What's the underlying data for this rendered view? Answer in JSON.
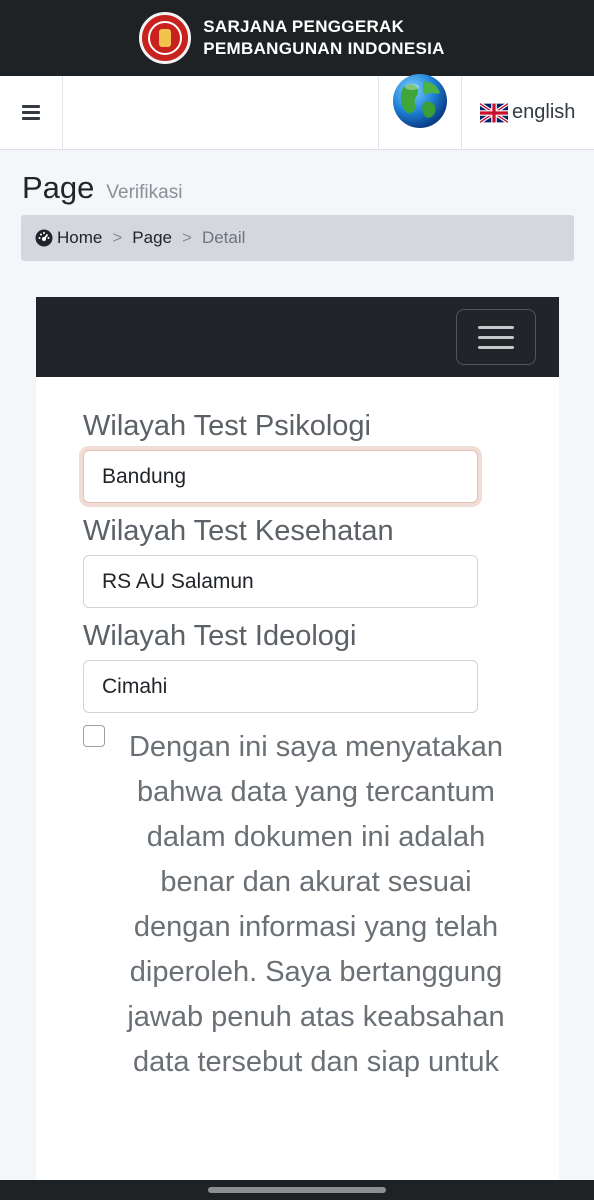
{
  "brand": {
    "line1": "SARJANA PENGGERAK",
    "line2": "PEMBANGUNAN INDONESIA",
    "logo_icon": "sppi-logo",
    "logo_color": "#c8221e"
  },
  "navbar": {
    "menu_icon": "hamburger-icon",
    "globe_icon": "globe-icon",
    "language_label": "english",
    "language_flag": "uk-flag-icon"
  },
  "page": {
    "title": "Page",
    "subtitle": "Verifikasi"
  },
  "breadcrumb": {
    "home": "Home",
    "sep1": ">",
    "page": "Page",
    "sep2": ">",
    "current": "Detail"
  },
  "form": {
    "psikologi_label": "Wilayah Test Psikologi",
    "psikologi_value": "Bandung",
    "kesehatan_label": "Wilayah Test Kesehatan",
    "kesehatan_value": "RS AU Salamun",
    "ideologi_label": "Wilayah Test Ideologi",
    "ideologi_value": "Cimahi",
    "statement": "Dengan ini saya menyatakan bahwa data yang tercantum dalam dokumen ini adalah benar dan akurat sesuai dengan informasi yang telah diperoleh. Saya bertanggung jawab penuh atas keabsahan data tersebut dan siap untuk",
    "agree_checked": false
  },
  "colors": {
    "dark_bar": "#1f2224",
    "card_header": "#212529",
    "focus_ring": "#f0ddd5"
  }
}
